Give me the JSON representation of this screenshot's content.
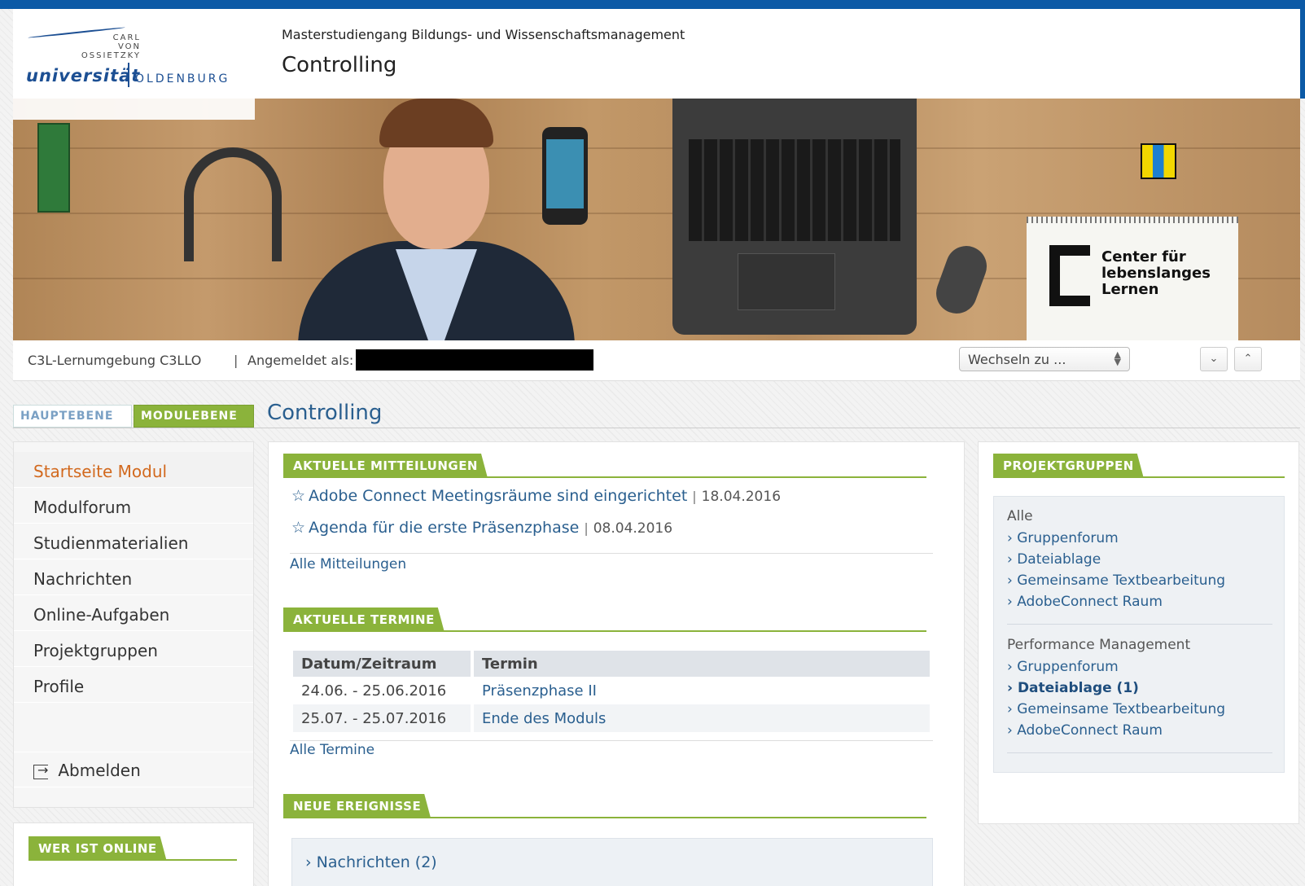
{
  "header": {
    "logo": {
      "small_lines": [
        "CARL",
        "VON",
        "OSSIETZKY"
      ],
      "uni": "universität",
      "city": "OLDENBURG"
    },
    "subtitle": "Masterstudiengang Bildungs- und Wissenschaftsmanagement",
    "title": "Controlling"
  },
  "banner": {
    "brand_text": [
      "Center für",
      "lebenslanges",
      "Lernen"
    ]
  },
  "infobar": {
    "environment": "C3L-Lernumgebung C3LLO",
    "separator": "|",
    "logged_in_label": "Angemeldet als:",
    "switch_select": "Wechseln zu ...",
    "nav_down": "⌄",
    "nav_up": "⌃"
  },
  "levels": {
    "tabs": [
      "HAUPTEBENE",
      "MODULEBENE"
    ],
    "active_tab": "MODULEBENE",
    "title": "Controlling"
  },
  "sidebar": {
    "items": [
      {
        "label": "Startseite Modul",
        "active": true
      },
      {
        "label": "Modulforum"
      },
      {
        "label": "Studienmaterialien"
      },
      {
        "label": "Nachrichten"
      },
      {
        "label": "Online-Aufgaben"
      },
      {
        "label": "Projektgruppen"
      },
      {
        "label": "Profile"
      }
    ],
    "logout": "Abmelden",
    "online_heading": "WER IST ONLINE"
  },
  "main": {
    "news": {
      "heading": "AKTUELLE MITTEILUNGEN",
      "items": [
        {
          "star": "☆",
          "title": "Adobe Connect Meetingsräume sind eingerichtet",
          "date": "18.04.2016"
        },
        {
          "star": "☆",
          "title": "Agenda für die erste Präsenzphase",
          "date": "08.04.2016"
        }
      ],
      "all_link": "Alle Mitteilungen"
    },
    "dates": {
      "heading": "AKTUELLE TERMINE",
      "columns": [
        "Datum/Zeitraum",
        "Termin"
      ],
      "rows": [
        [
          "24.06. - 25.06.2016",
          "Präsenzphase II"
        ],
        [
          "25.07. - 25.07.2016",
          "Ende des Moduls"
        ]
      ],
      "all_link": "Alle Termine"
    },
    "events": {
      "heading": "NEUE EREIGNISSE",
      "items": [
        "Nachrichten (2)"
      ]
    }
  },
  "right": {
    "heading": "PROJEKTGRUPPEN",
    "groups": [
      {
        "name": "Alle",
        "links": [
          "Gruppenforum",
          "Dateiablage",
          "Gemeinsame Textbearbeitung",
          "AdobeConnect Raum"
        ]
      },
      {
        "name": "Performance Management",
        "links": [
          "Gruppenforum",
          "Dateiablage (1)",
          "Gemeinsame Textbearbeitung",
          "AdobeConnect Raum"
        ]
      }
    ],
    "link_prefix": "›"
  },
  "colors": {
    "brand_blue": "#0c5aa6",
    "accent_green": "#8bb33b",
    "link_blue": "#2a5f8f",
    "active_orange": "#d2691e"
  }
}
